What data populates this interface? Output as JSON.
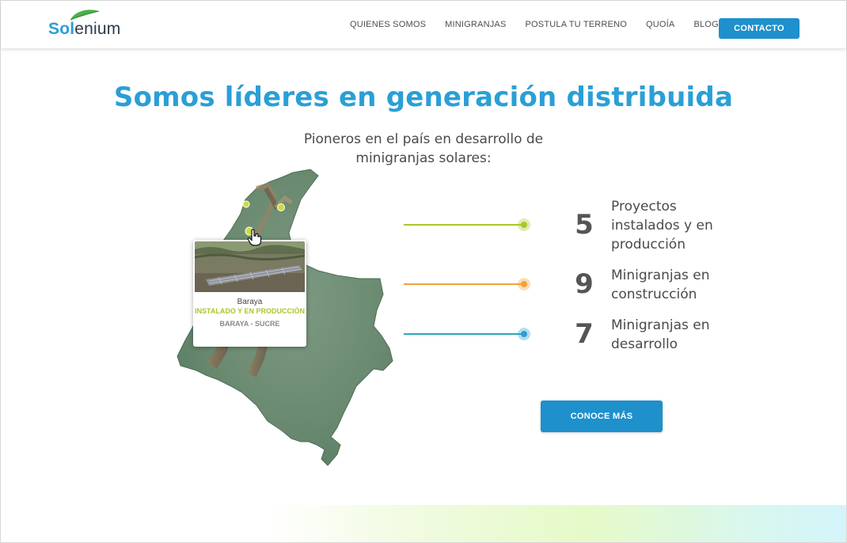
{
  "brand": {
    "logo_part1": "Sol",
    "logo_part2": "enium",
    "primary_color": "#2a9fd6",
    "button_color": "#1e90cc"
  },
  "nav": {
    "items": [
      "QUIENES SOMOS",
      "MINIGRANJAS",
      "POSTULA TU TERRENO",
      "QUOÍA",
      "BLOG"
    ],
    "contact_label": "CONTACTO"
  },
  "hero": {
    "title": "Somos líderes en generación distribuida",
    "subtitle": "Pioneros en el país en desarrollo de minigranjas solares:"
  },
  "map_popup": {
    "name": "Baraya",
    "status": "INSTALADO Y EN PRODUCCIÓN",
    "location": "BARAYA - SUCRE"
  },
  "stats": [
    {
      "number": "5",
      "label": "Proyectos instalados y en producción",
      "color": "#a8c72b"
    },
    {
      "number": "9",
      "label": "Minigranjas en construcción",
      "color": "#f2a13b"
    },
    {
      "number": "7",
      "label": "Minigranjas en desarrollo",
      "color": "#2a9fd6"
    }
  ],
  "cta": {
    "label": "CONOCE MÁS"
  }
}
